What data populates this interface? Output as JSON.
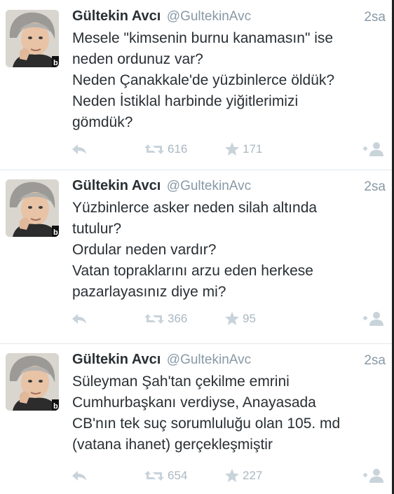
{
  "tweets": [
    {
      "author": {
        "name": "Gültekin Avcı",
        "handle": "@GultekinAvc"
      },
      "time": "2sa",
      "lines": [
        "Mesele \"kimsenin burnu kanamasın\" ise",
        "neden ordunuz var?",
        "Neden Çanakkale'de yüzbinlerce öldük?",
        "Neden İstiklal harbinde yiğitlerimizi",
        "gömdük?"
      ],
      "retweets": "616",
      "favorites": "171"
    },
    {
      "author": {
        "name": "Gültekin Avcı",
        "handle": "@GultekinAvc"
      },
      "time": "2sa",
      "lines": [
        "Yüzbinlerce asker neden silah altında",
        "tutulur?",
        "Ordular neden vardır?",
        "Vatan topraklarını arzu eden herkese",
        "pazarlayasınız diye mi?"
      ],
      "retweets": "366",
      "favorites": "95"
    },
    {
      "author": {
        "name": "Gültekin Avcı",
        "handle": "@GultekinAvc"
      },
      "time": "2sa",
      "lines": [
        "Süleyman Şah'tan çekilme emrini",
        "Cumhurbaşkanı verdiyse, Anayasada",
        "CB'nın tek suç sorumluluğu olan 105. md",
        "(vatana ihanet) gerçekleşmiştir"
      ],
      "retweets": "654",
      "favorites": "227"
    }
  ],
  "icons": {
    "reply": "reply-icon",
    "retweet": "retweet-icon",
    "favorite": "star-icon",
    "follow": "follow-icon"
  },
  "colors": {
    "text": "#292f33",
    "meta": "#8899a6",
    "action": "#aab8c2",
    "divider": "#e1e8ed"
  }
}
